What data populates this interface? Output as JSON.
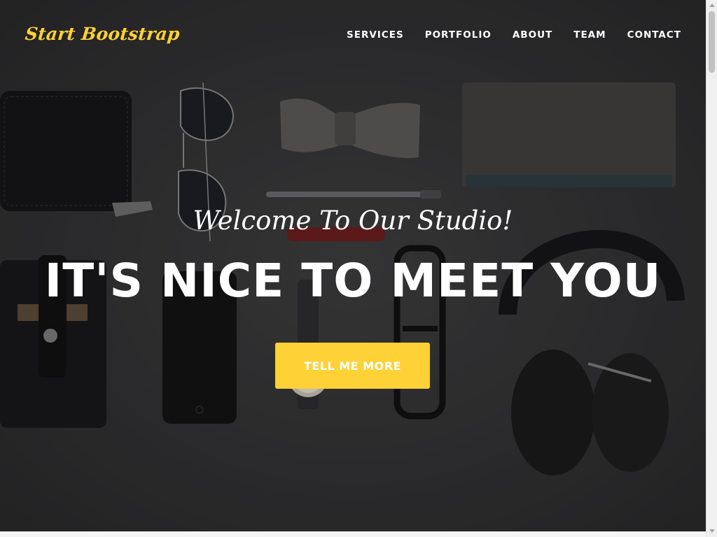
{
  "navbar": {
    "brand": "Start Bootstrap",
    "links": [
      {
        "label": "SERVICES"
      },
      {
        "label": "PORTFOLIO"
      },
      {
        "label": "ABOUT"
      },
      {
        "label": "TEAM"
      },
      {
        "label": "CONTACT"
      }
    ]
  },
  "hero": {
    "subheading": "Welcome To Our Studio!",
    "heading": "IT'S NICE TO MEET YOU",
    "cta_label": "TELL ME MORE",
    "photo_objects": [
      "wallet",
      "aviator-sunglasses",
      "bow-tie",
      "pen",
      "notebook",
      "card-sleeve",
      "smartphone",
      "pocket-knife",
      "wristwatch",
      "eyeglasses",
      "headphones"
    ]
  },
  "colors": {
    "accent": "#fed136",
    "background": "#2f2f31",
    "text": "#ffffff"
  },
  "scrollbar": {
    "position": 0
  }
}
